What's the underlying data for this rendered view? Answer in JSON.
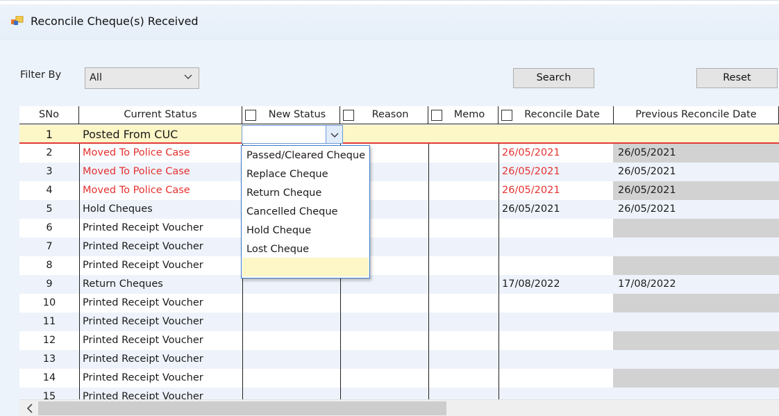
{
  "window": {
    "title": "Reconcile Cheque(s) Received",
    "icon": "window-app-icon"
  },
  "filter": {
    "label": "Filter By",
    "value": "All"
  },
  "buttons": {
    "search": "Search",
    "reset": "Reset"
  },
  "columns": {
    "sno": "SNo",
    "current_status": "Current Status",
    "new_status": "New Status",
    "reason": "Reason",
    "memo": "Memo",
    "reconcile_date": "Reconcile Date",
    "previous_reconcile_date": "Previous Reconcile Date"
  },
  "rows": [
    {
      "sno": "1",
      "status": "Posted From CUC",
      "reconcile": "",
      "previous": ""
    },
    {
      "sno": "2",
      "status": "Moved To Police Case",
      "reconcile": "26/05/2021",
      "previous": "26/05/2021"
    },
    {
      "sno": "3",
      "status": "Moved To Police Case",
      "reconcile": "26/05/2021",
      "previous": "26/05/2021"
    },
    {
      "sno": "4",
      "status": "Moved To Police Case",
      "reconcile": "26/05/2021",
      "previous": "26/05/2021"
    },
    {
      "sno": "5",
      "status": "Hold Cheques",
      "reconcile": "26/05/2021",
      "previous": "26/05/2021"
    },
    {
      "sno": "6",
      "status": "Printed Receipt Voucher",
      "reconcile": "",
      "previous": ""
    },
    {
      "sno": "7",
      "status": "Printed Receipt Voucher",
      "reconcile": "",
      "previous": ""
    },
    {
      "sno": "8",
      "status": "Printed Receipt Voucher",
      "reconcile": "",
      "previous": ""
    },
    {
      "sno": "9",
      "status": "Return Cheques",
      "reconcile": "17/08/2022",
      "previous": "17/08/2022"
    },
    {
      "sno": "10",
      "status": "Printed Receipt Voucher",
      "reconcile": "",
      "previous": ""
    },
    {
      "sno": "11",
      "status": "Printed Receipt Voucher",
      "reconcile": "",
      "previous": ""
    },
    {
      "sno": "12",
      "status": "Printed Receipt Voucher",
      "reconcile": "",
      "previous": ""
    },
    {
      "sno": "13",
      "status": "Printed Receipt Voucher",
      "reconcile": "",
      "previous": ""
    },
    {
      "sno": "14",
      "status": "Printed Receipt Voucher",
      "reconcile": "",
      "previous": ""
    },
    {
      "sno": "15",
      "status": "Printed Receipt Voucher",
      "reconcile": "",
      "previous": ""
    }
  ],
  "dropdown_options": [
    "Passed/Cleared Cheque",
    "Replace Cheque",
    "Return Cheque",
    "Cancelled Cheque",
    "Hold Cheque",
    "Lost Cheque",
    ""
  ],
  "colors": {
    "warning_text": "#e5312f",
    "selected_row": "#fdf6c7",
    "focus_border": "#3e7ac8"
  }
}
